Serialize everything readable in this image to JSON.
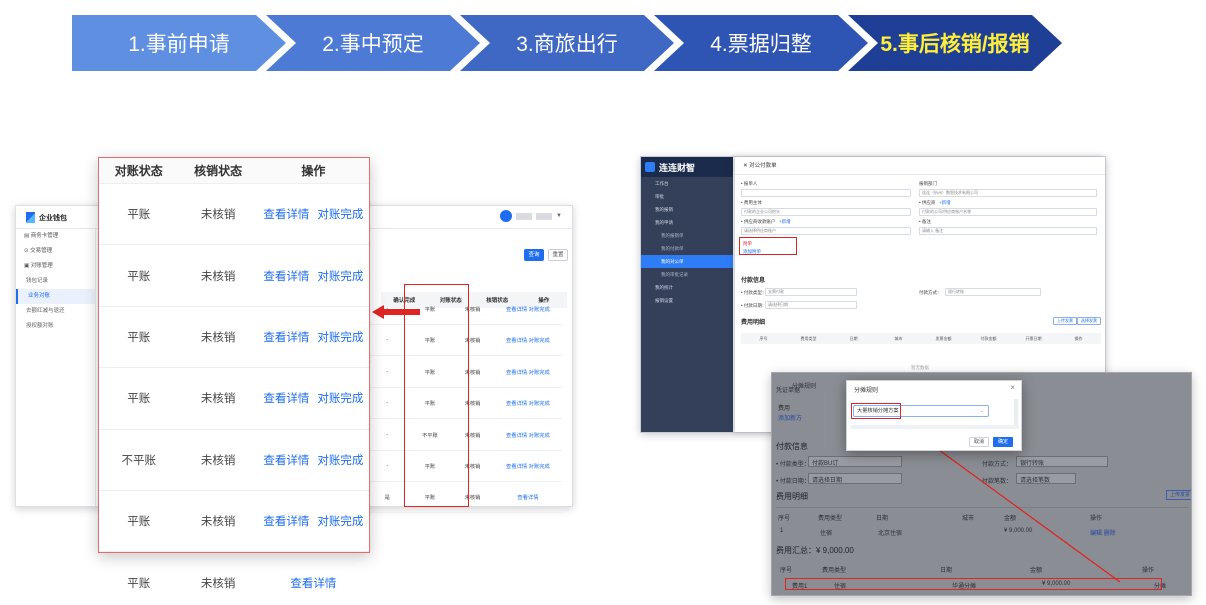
{
  "process_steps": [
    "1.事前申请",
    "2.事中预定",
    "3.商旅出行",
    "4.票据归整",
    "5.事后核销/报销"
  ],
  "left_app": {
    "logo": "企业钱包",
    "sidebar": [
      {
        "label": "商务卡管理",
        "caret": "⌄"
      },
      {
        "label": "交易管理",
        "caret": "⌄"
      },
      {
        "label": "对账管理",
        "caret": "⌃"
      },
      {
        "label": "钱包记录"
      },
      {
        "label": "业务对账"
      },
      {
        "label": "去额红减与退还"
      },
      {
        "label": "授权额对账"
      }
    ],
    "buttons": {
      "query": "查询",
      "reset": "重置"
    },
    "mini_header": [
      "确认完成",
      "对账状态",
      "核销状态",
      "操作"
    ],
    "mini_rows": [
      [
        "-",
        "平账",
        "未核销",
        "查看详情",
        "对账完成"
      ],
      [
        "-",
        "平账",
        "未核销",
        "查看详情",
        "对账完成"
      ],
      [
        "-",
        "平账",
        "未核销",
        "查看详情",
        "对账完成"
      ],
      [
        "-",
        "平账",
        "未核销",
        "查看详情",
        "对账完成"
      ],
      [
        "-",
        "不平账",
        "未核销",
        "查看详情",
        "对账完成"
      ],
      [
        "-",
        "平账",
        "未核销",
        "查看详情",
        "对账完成"
      ],
      [
        "是",
        "平账",
        "未核销",
        "查看详情",
        ""
      ]
    ]
  },
  "zoom_table": {
    "headers": [
      "对账状态",
      "核销状态",
      "操作"
    ],
    "rows": [
      {
        "status": "平账",
        "writeoff": "未核销",
        "detail": "查看详情",
        "complete": "对账完成"
      },
      {
        "status": "平账",
        "writeoff": "未核销",
        "detail": "查看详情",
        "complete": "对账完成"
      },
      {
        "status": "平账",
        "writeoff": "未核销",
        "detail": "查看详情",
        "complete": "对账完成"
      },
      {
        "status": "平账",
        "writeoff": "未核销",
        "detail": "查看详情",
        "complete": "对账完成"
      },
      {
        "status": "不平账",
        "writeoff": "未核销",
        "detail": "查看详情",
        "complete": "对账完成"
      },
      {
        "status": "平账",
        "writeoff": "未核销",
        "detail": "查看详情",
        "complete": "对账完成"
      },
      {
        "status": "平账",
        "writeoff": "未核销",
        "detail": "查看详情",
        "complete": ""
      }
    ]
  },
  "right_app": {
    "brand": "连连财智",
    "sidebar": [
      "工作台",
      "审批",
      "我的报销",
      "我的申请",
      "我的报销单",
      "我的付款单",
      "我的对公单",
      "我的审批记录",
      "我的统计",
      "报销设置"
    ],
    "panel_title": "对公付款单",
    "labels": {
      "applicant": "• 报单人",
      "department": "报销部门",
      "dept_value": "连连（杭州）数智技术有限公司",
      "title": "• 费用主体",
      "payee": "• 供应商",
      "payee_add": "+新增",
      "company_val": "付款的企业公司抬头",
      "payee_val": "付款的公司/供应商账户名称",
      "account": "• 供应商收款账户",
      "account_add": "+新增",
      "remark": "• 备注",
      "remark_ph": "请输入 备注",
      "account_ph": "请选择供应商账户",
      "attach": "附单",
      "attach_link": "添加附单"
    },
    "pay_section": "付款信息",
    "pay_type": "• 付款类型：",
    "pay_type_val": "支票付款",
    "pay_method": "付款方式：",
    "pay_method_val": "银行转账",
    "pay_date": "• 付款日期：",
    "pay_date_ph": "请选择日期",
    "fee_section": "费用明细",
    "fee_buttons": [
      "上传发票",
      "选择发票"
    ],
    "fee_cols": [
      "序号",
      "费用类型",
      "日期",
      "城市",
      "发票金额",
      "付款金额",
      "开票日期",
      "操作"
    ],
    "empty": "暂无数据"
  },
  "right_zoom": {
    "labels": {
      "rules": "分摊规则",
      "voucher": "凭证单据",
      "fee_dept": "费用",
      "add_rule": "添加新方",
      "pay_info": "付款信息",
      "pay_type": "• 付款类型：",
      "pay_type_val": "付款BU订",
      "pay_method": "付款方式：",
      "pay_method_val": "银行转账",
      "pay_date": "• 付款日期：",
      "pay_date_ph": "请选择日期",
      "pay_count": "付款笔数：",
      "pay_count_ph": "请选择笔数",
      "fee_detail": "费用明细",
      "fee_btn": "上传发票",
      "row_idx": "1",
      "row_type": "住宿",
      "row_city": "北京住宿",
      "row_amount": "¥ 9,000.00",
      "row_ops": "编辑 删除",
      "total_label": "费用汇总：¥ 9,000.00",
      "bottom_row": [
        "费用1",
        "住宿",
        "华通分摊",
        "¥ 9,000.00",
        "分摊"
      ]
    },
    "grid_head": [
      "序号",
      "费用类型",
      "日期",
      "城市",
      "金额",
      "操作"
    ],
    "bottom_head": [
      "序号",
      "费用类型",
      "日期",
      "金额",
      "操作"
    ]
  },
  "dialog": {
    "title": "分摊规则",
    "close": "×",
    "select_value": "大量核销分摊方案",
    "cancel": "取消",
    "ok": "确定"
  }
}
